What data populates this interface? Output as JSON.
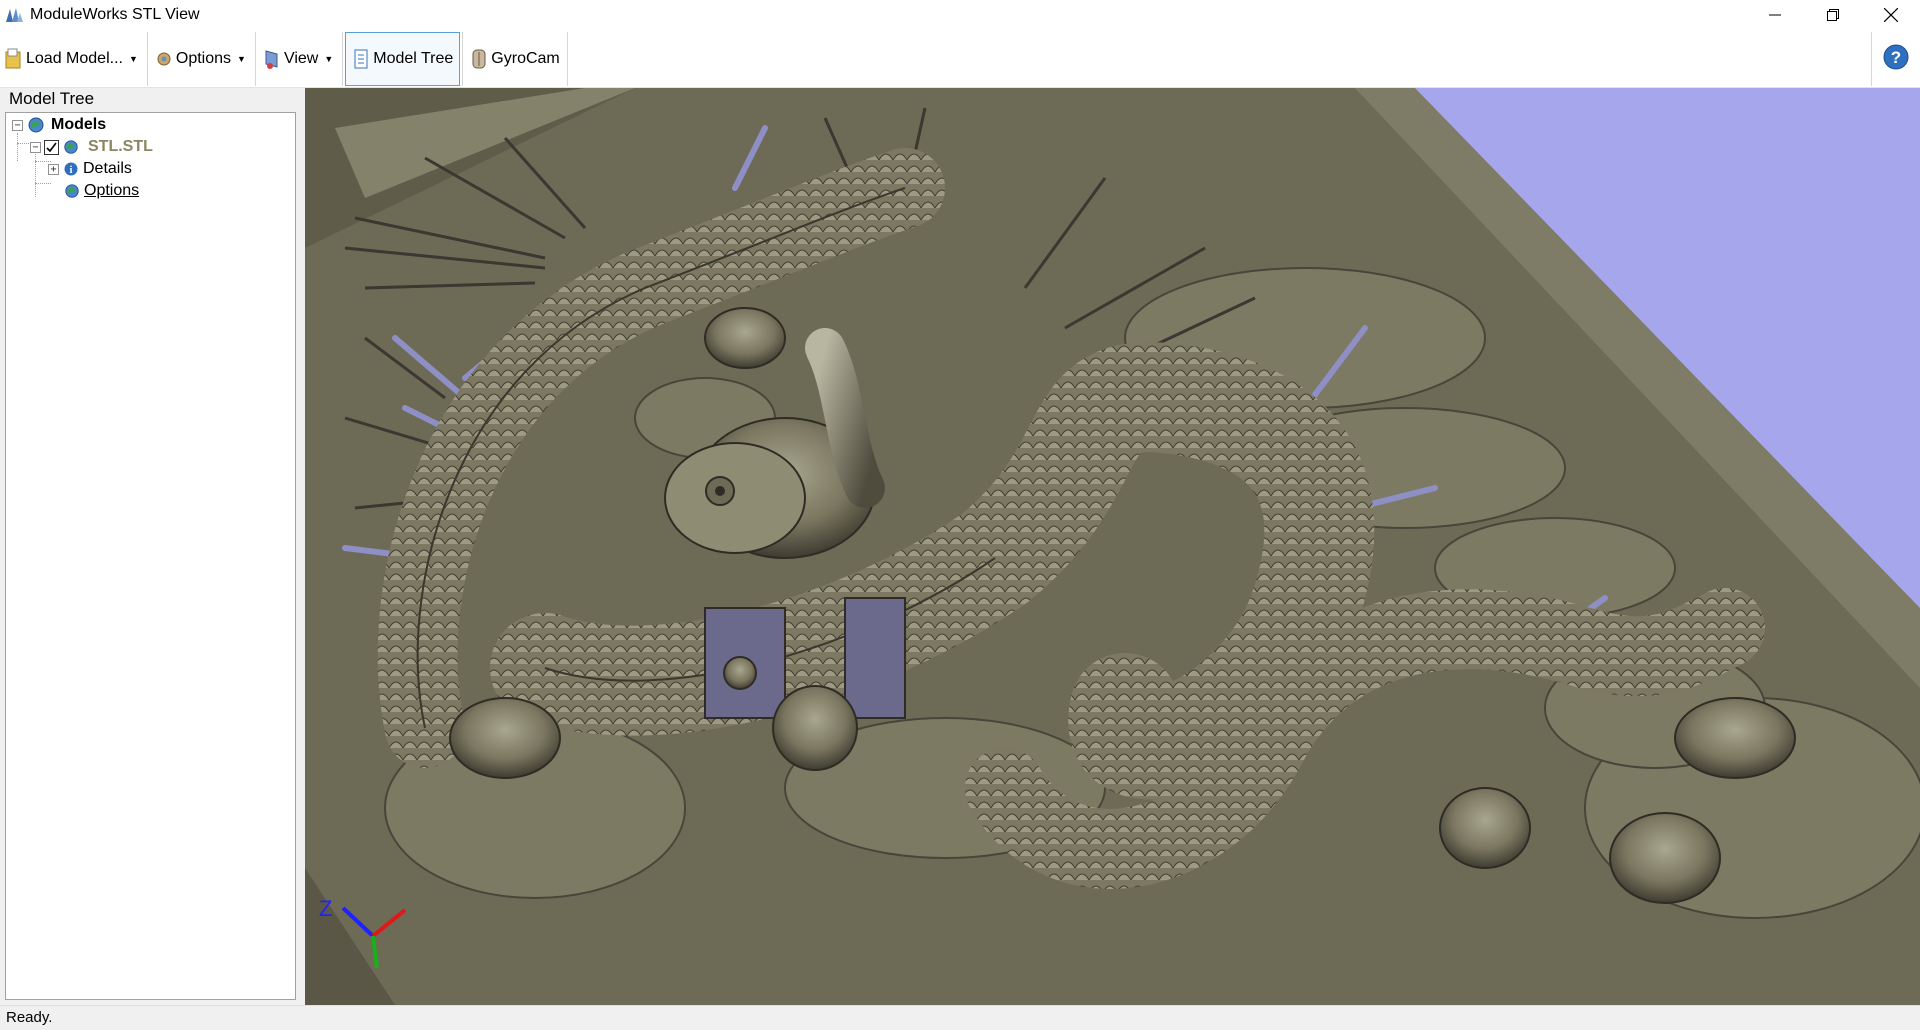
{
  "window": {
    "title": "ModuleWorks STL View",
    "icon": "moduleworks-logo-icon",
    "controls": [
      "minimize-icon",
      "restore-icon",
      "close-icon"
    ]
  },
  "toolbar": {
    "load_model_label": "Load Model...",
    "options_label": "Options",
    "view_label": "View",
    "model_tree_label": "Model Tree",
    "gyrocam_label": "GyroCam",
    "help_icon": "help-icon"
  },
  "model_tree": {
    "panel_title": "Model Tree",
    "root_label": "Models",
    "model_label": "STL.STL",
    "details_label": "Details",
    "options_label": "Options"
  },
  "viewport": {
    "axes": {
      "z_label": "Z"
    },
    "colors": {
      "sky": "#a6a6ec",
      "model": "#6d6a56",
      "highlight": "#9191bf"
    }
  },
  "statusbar": {
    "text": "Ready."
  }
}
